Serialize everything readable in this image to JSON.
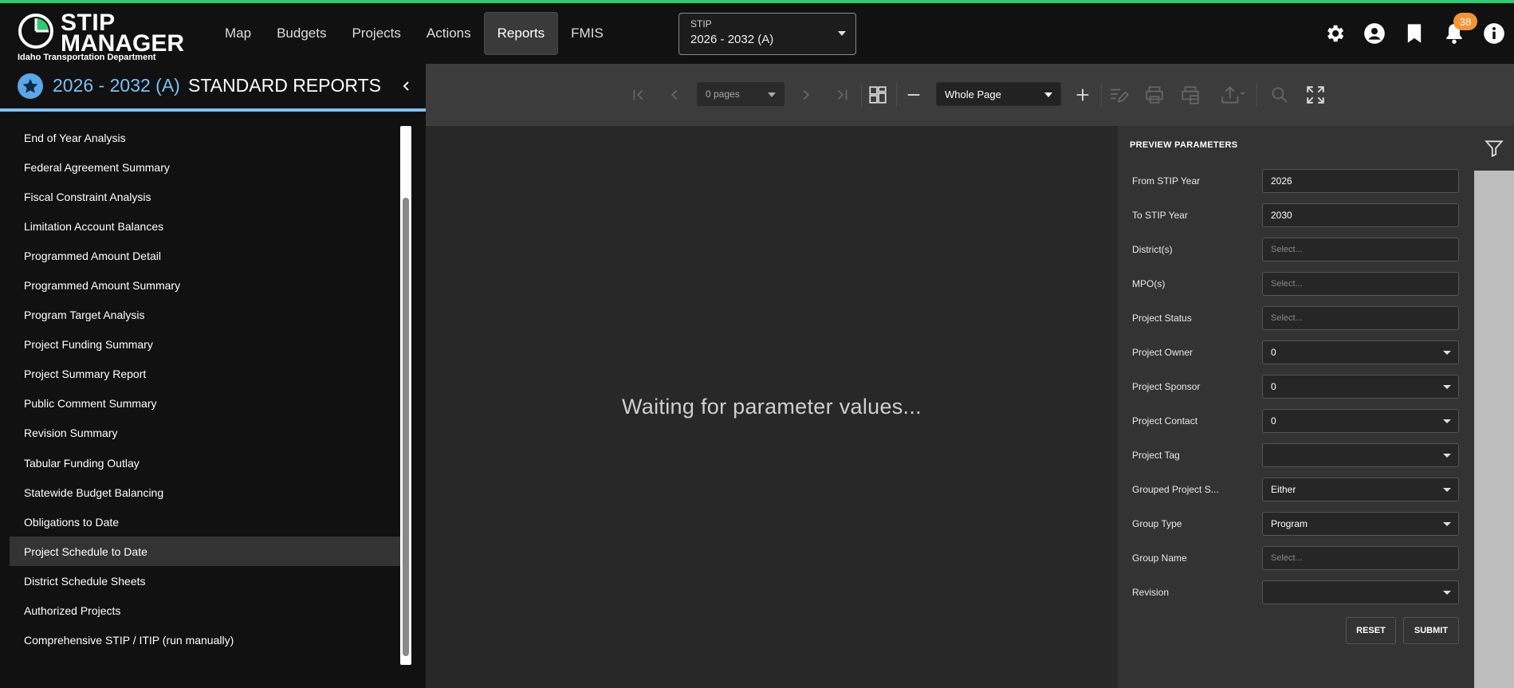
{
  "app": {
    "logo_line1": "STIP",
    "logo_line2": "MANAGER",
    "logo_sub": "Idaho Transportation Department"
  },
  "nav": {
    "items": [
      "Map",
      "Budgets",
      "Projects",
      "Actions",
      "Reports",
      "FMIS"
    ],
    "active": "Reports"
  },
  "stip_select": {
    "label": "STIP",
    "value": "2026 - 2032 (A)"
  },
  "notifications": {
    "count": "38"
  },
  "sidebar": {
    "year": "2026 - 2032 (A)",
    "title": "STANDARD REPORTS",
    "reports": [
      "End of Year Analysis",
      "Federal Agreement Summary",
      "Fiscal Constraint Analysis",
      "Limitation Account Balances",
      "Programmed Amount Detail",
      "Programmed Amount Summary",
      "Program Target Analysis",
      "Project Funding Summary",
      "Project Summary Report",
      "Public Comment Summary",
      "Revision Summary",
      "Tabular Funding Outlay",
      "Statewide Budget Balancing",
      "Obligations to Date",
      "Project Schedule to Date",
      "District Schedule Sheets",
      "Authorized Projects",
      "Comprehensive STIP / ITIP (run manually)"
    ],
    "active_report": "Project Schedule to Date"
  },
  "toolbar": {
    "pages_value": "0 pages",
    "zoom_value": "Whole Page"
  },
  "viewer": {
    "waiting_text": "Waiting for parameter values..."
  },
  "params": {
    "title": "PREVIEW PARAMETERS",
    "fields": [
      {
        "label": "From STIP Year",
        "value": "2026",
        "kind": "text"
      },
      {
        "label": "To STIP Year",
        "value": "2030",
        "kind": "text"
      },
      {
        "label": "District(s)",
        "value": "Select...",
        "kind": "placeholder"
      },
      {
        "label": "MPO(s)",
        "value": "Select...",
        "kind": "placeholder"
      },
      {
        "label": "Project Status",
        "value": "Select...",
        "kind": "placeholder"
      },
      {
        "label": "Project Owner",
        "value": "0",
        "kind": "dropdown"
      },
      {
        "label": "Project Sponsor",
        "value": "0",
        "kind": "dropdown"
      },
      {
        "label": "Project Contact",
        "value": "0",
        "kind": "dropdown"
      },
      {
        "label": "Project Tag",
        "value": "",
        "kind": "dropdown"
      },
      {
        "label": "Grouped Project S...",
        "value": "Either",
        "kind": "dropdown"
      },
      {
        "label": "Group Type",
        "value": "Program",
        "kind": "dropdown"
      },
      {
        "label": "Group Name",
        "value": "Select...",
        "kind": "placeholder"
      },
      {
        "label": "Revision",
        "value": "",
        "kind": "dropdown"
      }
    ],
    "reset_label": "RESET",
    "submit_label": "SUBMIT"
  },
  "colors": {
    "accent_green": "#2ecc71",
    "accent_blue": "#7cc0f5",
    "badge_orange": "#f39533"
  }
}
